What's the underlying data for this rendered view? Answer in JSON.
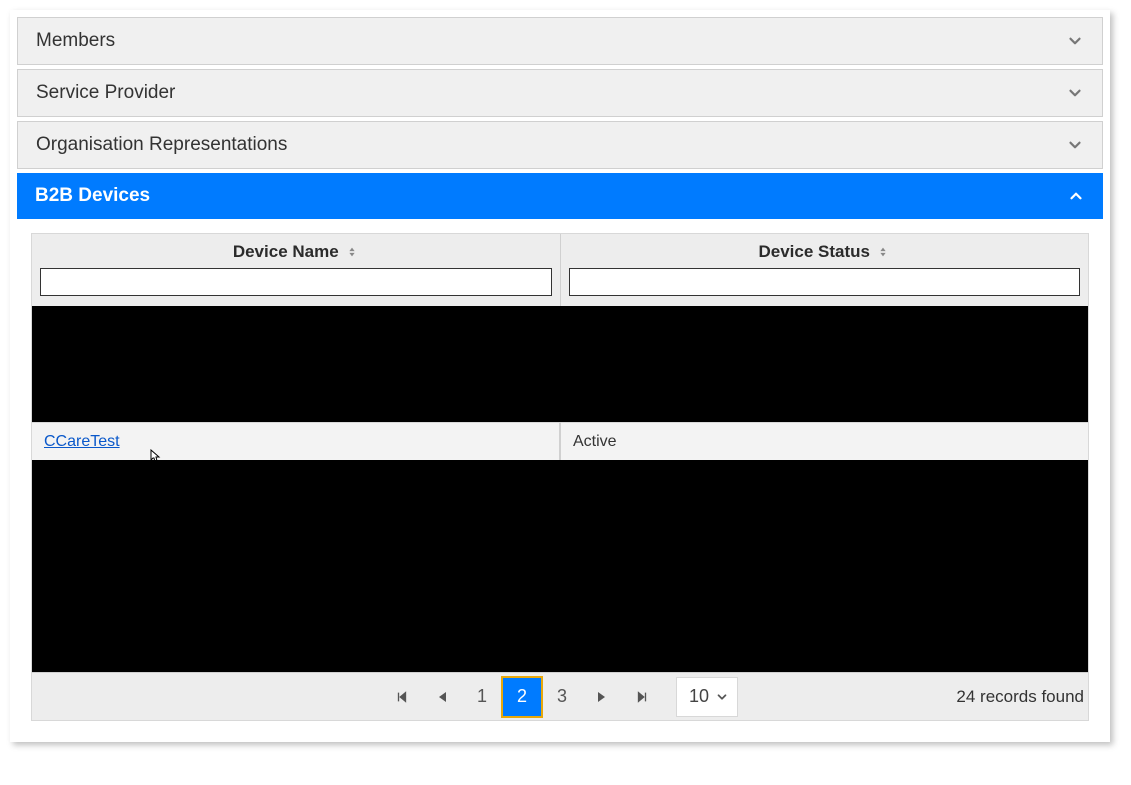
{
  "accordion": {
    "members": {
      "label": "Members"
    },
    "service_provider": {
      "label": "Service Provider"
    },
    "org_reps": {
      "label": "Organisation Representations"
    },
    "b2b_devices": {
      "label": "B2B Devices"
    }
  },
  "grid": {
    "columns": {
      "device_name": {
        "label": "Device Name",
        "filter_value": ""
      },
      "device_status": {
        "label": "Device Status",
        "filter_value": ""
      }
    },
    "rows": [
      {
        "redacted": true,
        "height": "tall",
        "device_name": "",
        "device_status": ""
      },
      {
        "redacted": false,
        "device_name": "CCareTest",
        "device_status": "Active"
      },
      {
        "redacted": true,
        "height": "xtall",
        "device_name": "",
        "device_status": ""
      }
    ]
  },
  "pagination": {
    "pages": [
      "1",
      "2",
      "3"
    ],
    "current": "2",
    "page_size": "10",
    "records_found": "24 records found"
  }
}
